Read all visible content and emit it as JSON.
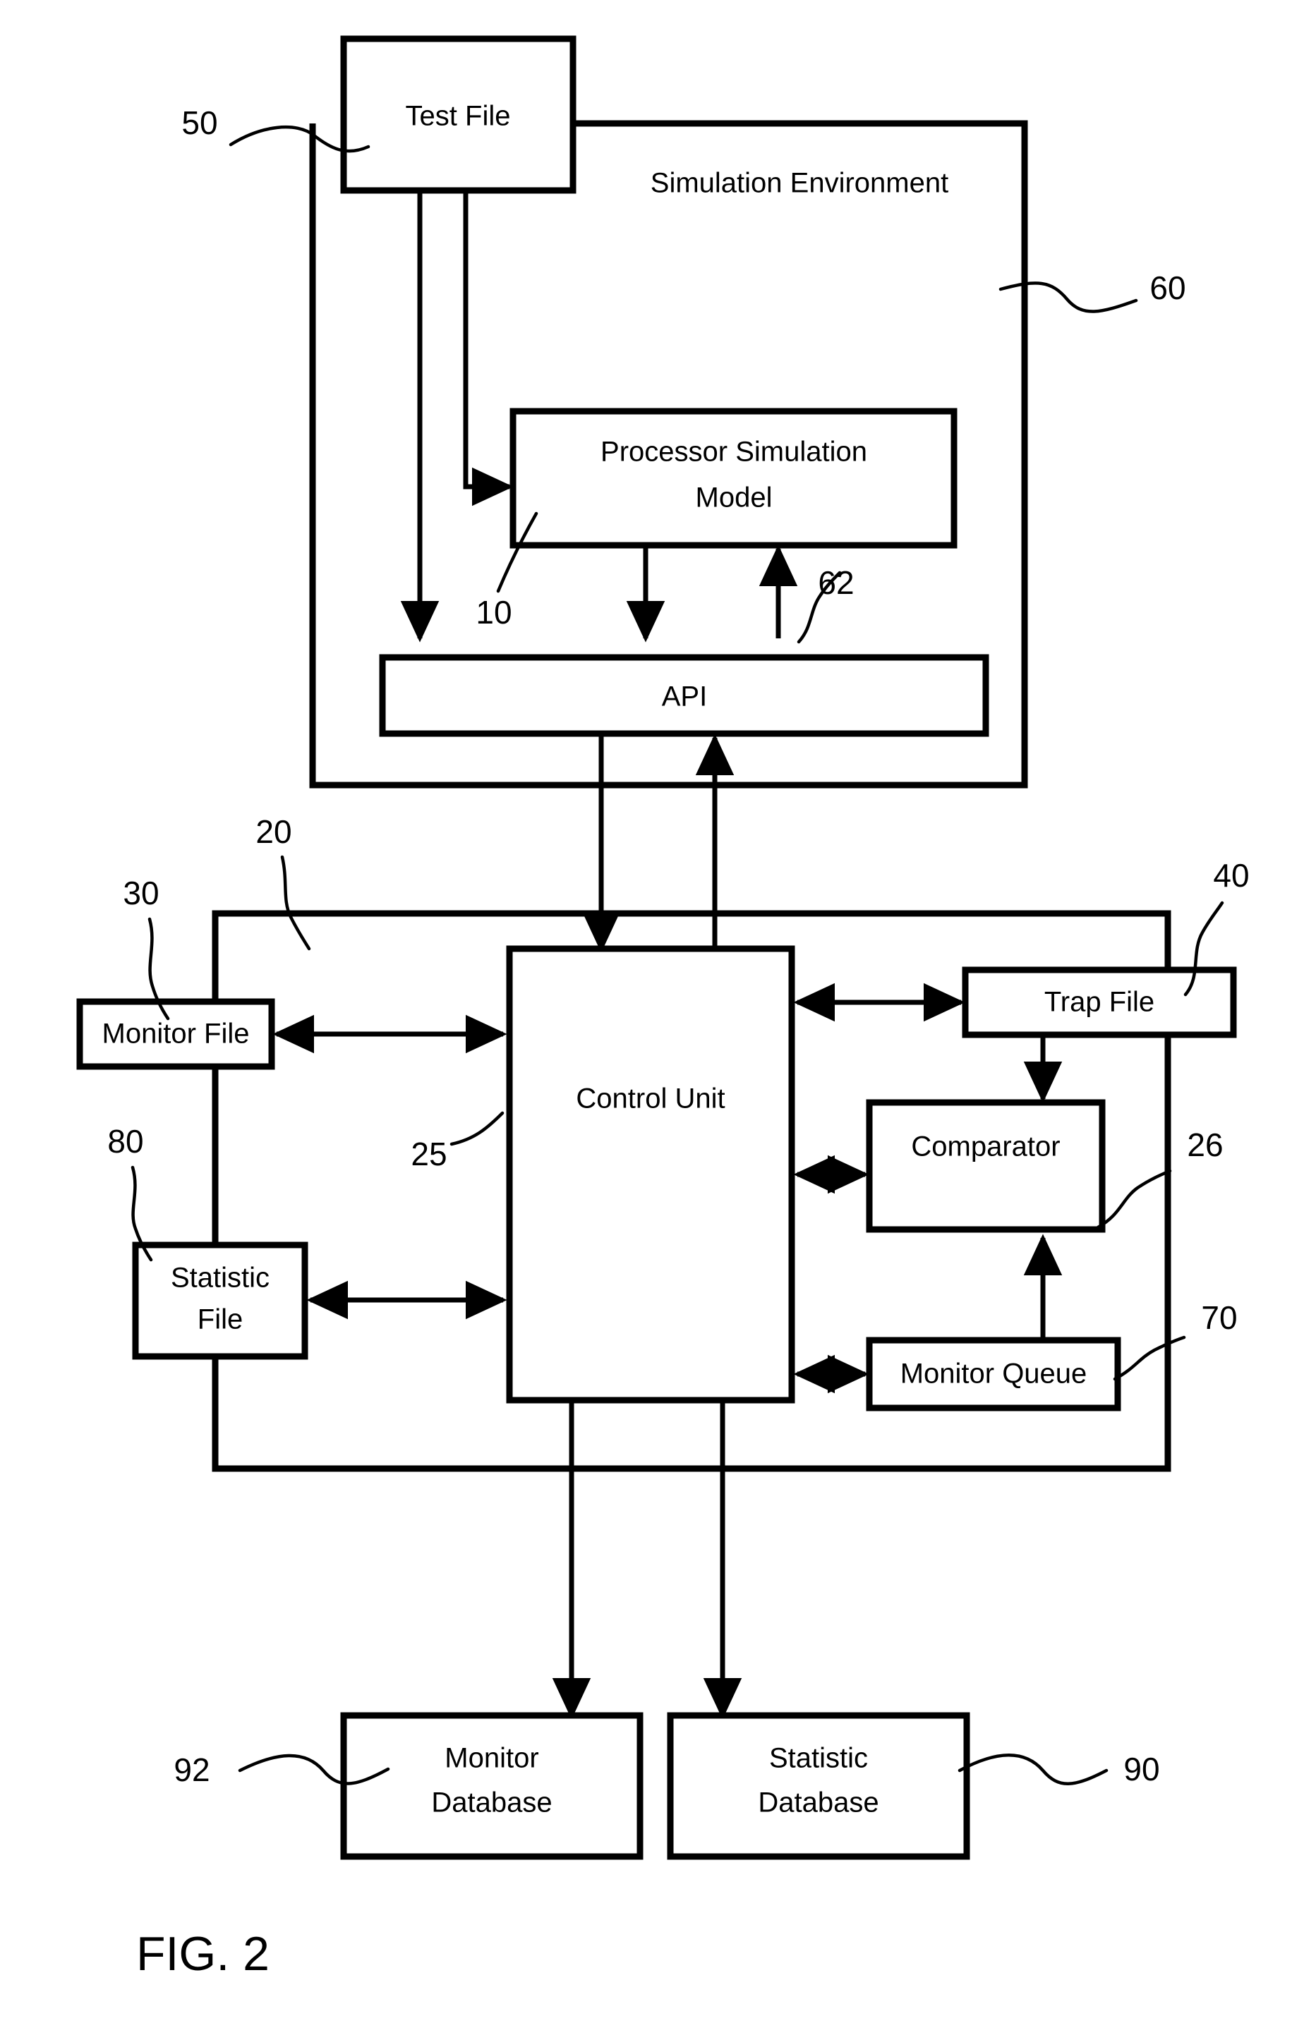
{
  "figure": {
    "caption": "FIG. 2",
    "title": "Processor simulation verification system block diagram"
  },
  "groups": [
    {
      "id": "simulation-environment",
      "label": "Simulation Environment",
      "ref": "60"
    },
    {
      "id": "control-group",
      "label": "",
      "ref": "20"
    }
  ],
  "blocks": [
    {
      "id": "test-file",
      "label": "Test File",
      "ref": "50"
    },
    {
      "id": "processor-simulation-model",
      "label_line1": "Processor Simulation",
      "label_line2": "Model",
      "ref": "10"
    },
    {
      "id": "api",
      "label": "API",
      "ref": "62"
    },
    {
      "id": "monitor-file",
      "label": "Monitor File",
      "ref": "30"
    },
    {
      "id": "statistic-file",
      "label_line1": "Statistic",
      "label_line2": "File",
      "ref": "80"
    },
    {
      "id": "control-unit",
      "label": "Control Unit",
      "ref": "25"
    },
    {
      "id": "trap-file",
      "label": "Trap File",
      "ref": "40"
    },
    {
      "id": "comparator",
      "label": "Comparator",
      "ref": "26"
    },
    {
      "id": "monitor-queue",
      "label": "Monitor Queue",
      "ref": "70"
    },
    {
      "id": "monitor-database",
      "label_line1": "Monitor",
      "label_line2": "Database",
      "ref": "92"
    },
    {
      "id": "statistic-database",
      "label_line1": "Statistic",
      "label_line2": "Database",
      "ref": "90"
    }
  ],
  "labels": {
    "test_file": "Test File",
    "simulation_environment": "Simulation Environment",
    "processor_sim_model_1": "Processor Simulation",
    "processor_sim_model_2": "Model",
    "api": "API",
    "monitor_file": "Monitor File",
    "statistic_file_1": "Statistic",
    "statistic_file_2": "File",
    "control_unit": "Control Unit",
    "trap_file": "Trap File",
    "comparator": "Comparator",
    "monitor_queue": "Monitor Queue",
    "monitor_database_1": "Monitor",
    "monitor_database_2": "Database",
    "statistic_database_1": "Statistic",
    "statistic_database_2": "Database",
    "fig_caption": "FIG. 2"
  },
  "refs": {
    "r50": "50",
    "r60": "60",
    "r10": "10",
    "r62": "62",
    "r20": "20",
    "r30": "30",
    "r40": "40",
    "r25": "25",
    "r26": "26",
    "r70": "70",
    "r80": "80",
    "r90": "90",
    "r92": "92"
  },
  "colors": {
    "stroke": "#000000",
    "background": "#ffffff"
  }
}
